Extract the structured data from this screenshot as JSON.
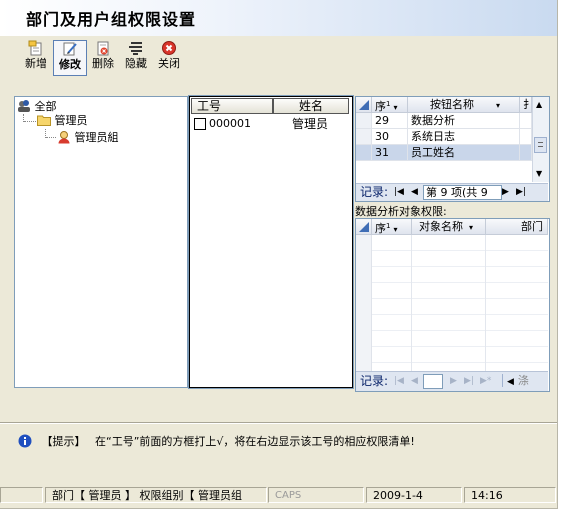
{
  "window": {
    "title": "部门及用户组权限设置"
  },
  "toolbar": {
    "add_label": "新增",
    "edit_label": "修改",
    "delete_label": "删除",
    "hide_label": "隐藏",
    "close_label": "关闭"
  },
  "tree": {
    "root": "全部",
    "dept": "管理员",
    "group": "管理员組"
  },
  "users": {
    "col_id": "工号",
    "col_name": "姓名",
    "rows": [
      {
        "id": "000001",
        "name": "管理员",
        "checked": false
      }
    ]
  },
  "buttons_grid": {
    "col_seq": "序",
    "col_name": "按钮名称",
    "col_extra": "扌",
    "rows": [
      {
        "seq": "29",
        "name": "数据分析"
      },
      {
        "seq": "30",
        "name": "系统日志"
      },
      {
        "seq": "31",
        "name": "员工姓名"
      }
    ],
    "nav_label": "记录:",
    "nav_text": "第 9 项(共 9"
  },
  "object_grid": {
    "title": "数据分析对象权限:",
    "col_seq": "序",
    "col_name": "对象名称",
    "col_dept": "部门",
    "nav_label": "记录:",
    "nav_tail": "涤"
  },
  "hint": {
    "label": "【提示】",
    "text": "在“工号”前面的方框打上√，将在右边显示该工号的相应权限清单!"
  },
  "status": {
    "dept_text": "部门【 管理员 】 权限组别【 管理员组",
    "caps": "CAPS",
    "date": "2009-1-4",
    "time": "14:16"
  }
}
